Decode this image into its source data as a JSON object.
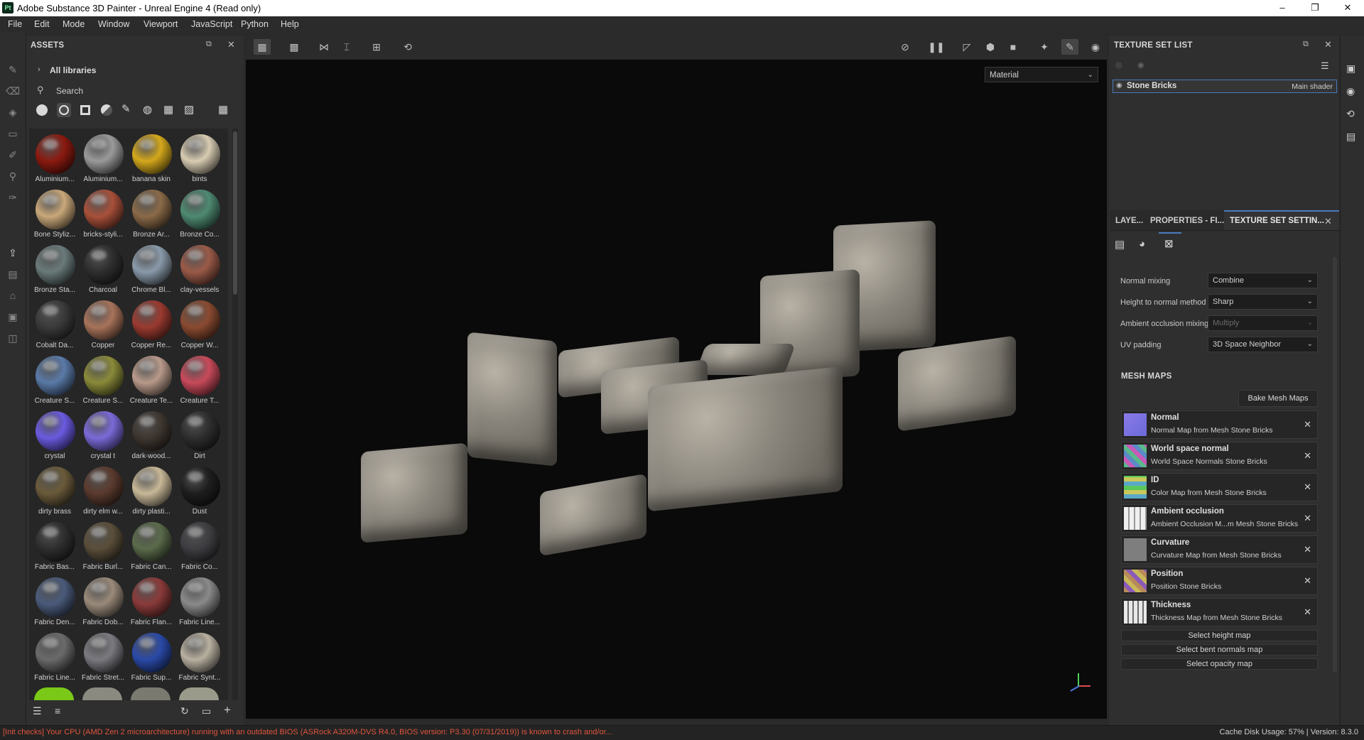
{
  "window": {
    "title": "Adobe Substance 3D Painter - Unreal Engine 4 (Read only)",
    "logo": "Pt",
    "controls": [
      "–",
      "❐",
      "✕"
    ]
  },
  "menu": [
    "File",
    "Edit",
    "Mode",
    "Window",
    "Viewport",
    "JavaScript",
    "Python",
    "Help"
  ],
  "assets": {
    "title": "ASSETS",
    "library": "All libraries",
    "search_placeholder": "Search",
    "items": [
      {
        "label": "Aluminium...",
        "color": "#8a1a10"
      },
      {
        "label": "Aluminium...",
        "color": "#9a9a9a"
      },
      {
        "label": "banana skin",
        "color": "#d4a81c"
      },
      {
        "label": "bints",
        "color": "#d8ccb2"
      },
      {
        "label": "Bone Styliz...",
        "color": "#c9a87a"
      },
      {
        "label": "bricks-styli...",
        "color": "#a8503a"
      },
      {
        "label": "Bronze Ar...",
        "color": "#8a6a48"
      },
      {
        "label": "Bronze Co...",
        "color": "#4e8a72"
      },
      {
        "label": "Bronze Sta...",
        "color": "#6a7a7a"
      },
      {
        "label": "Charcoal",
        "color": "#2e2e2e"
      },
      {
        "label": "Chrome Bl...",
        "color": "#8a9aaa"
      },
      {
        "label": "clay-vessels",
        "color": "#9a5a48"
      },
      {
        "label": "Cobalt Da...",
        "color": "#3a3a3a"
      },
      {
        "label": "Copper",
        "color": "#a8735a"
      },
      {
        "label": "Copper Re...",
        "color": "#9a3a30"
      },
      {
        "label": "Copper W...",
        "color": "#8a4a30"
      },
      {
        "label": "Creature S...",
        "color": "#5a7aa8"
      },
      {
        "label": "Creature S...",
        "color": "#8a8a3a"
      },
      {
        "label": "Creature Te...",
        "color": "#b89a8a"
      },
      {
        "label": "Creature T...",
        "color": "#c84a5a"
      },
      {
        "label": "crystal",
        "color": "#6a5ae0"
      },
      {
        "label": "crystal t",
        "color": "#7a6ad8"
      },
      {
        "label": "dark-wood...",
        "color": "#3e3630"
      },
      {
        "label": "Dirt",
        "color": "#2e2e2e"
      },
      {
        "label": "dirty brass",
        "color": "#6a5a3a"
      },
      {
        "label": "dirty elm w...",
        "color": "#5a3a2e"
      },
      {
        "label": "dirty plasti...",
        "color": "#c8b898"
      },
      {
        "label": "Dust",
        "color": "#1e1e1e"
      },
      {
        "label": "Fabric Bas...",
        "color": "#2e2e2e"
      },
      {
        "label": "Fabric Burl...",
        "color": "#5a4e3a"
      },
      {
        "label": "Fabric Can...",
        "color": "#5a6a4a"
      },
      {
        "label": "Fabric Co...",
        "color": "#3e3e42"
      },
      {
        "label": "Fabric Den...",
        "color": "#4a5a7a"
      },
      {
        "label": "Fabric Dob...",
        "color": "#9a8a7a"
      },
      {
        "label": "Fabric Flan...",
        "color": "#8a3a3a"
      },
      {
        "label": "Fabric Line...",
        "color": "#8a8a8a"
      },
      {
        "label": "Fabric Line...",
        "color": "#6a6a6a"
      },
      {
        "label": "Fabric Stret...",
        "color": "#7a7a80"
      },
      {
        "label": "Fabric Sup...",
        "color": "#2a4aa8"
      },
      {
        "label": "Fabric Synt...",
        "color": "#b8b0a0"
      }
    ]
  },
  "viewport": {
    "material_mode": "Material"
  },
  "texture_set_list": {
    "title": "TEXTURE SET LIST",
    "set_name": "Stone Bricks",
    "shader": "Main shader"
  },
  "tabs": [
    "LAYE...",
    "PROPERTIES - FI...",
    "TEXTURE SET SETTIN..."
  ],
  "settings": {
    "rows": [
      {
        "label": "Normal mixing",
        "value": "Combine",
        "disabled": false
      },
      {
        "label": "Height to normal method",
        "value": "Sharp",
        "disabled": false
      },
      {
        "label": "Ambient occlusion mixing",
        "value": "Multiply",
        "disabled": true
      },
      {
        "label": "UV padding",
        "value": "3D Space Neighbor",
        "disabled": false
      }
    ],
    "mesh_maps_title": "MESH MAPS",
    "bake_label": "Bake Mesh Maps",
    "mesh_maps": [
      {
        "title": "Normal",
        "sub": "Normal Map from Mesh Stone Bricks",
        "color": "#7a7ae8"
      },
      {
        "title": "World space normal",
        "sub": "World Space Normals Stone Bricks",
        "color": "#5ab88a"
      },
      {
        "title": "ID",
        "sub": "Color Map from Mesh Stone Bricks",
        "color": "#5aa8c8"
      },
      {
        "title": "Ambient occlusion",
        "sub": "Ambient Occlusion M...m Mesh Stone Bricks",
        "color": "#e0e0e0"
      },
      {
        "title": "Curvature",
        "sub": "Curvature Map from Mesh Stone Bricks",
        "color": "#8a8a8a"
      },
      {
        "title": "Position",
        "sub": "Position Stone Bricks",
        "color": "#b88a5a"
      },
      {
        "title": "Thickness",
        "sub": "Thickness Map from Mesh Stone Bricks",
        "color": "#cfcfcf"
      }
    ],
    "select_buttons": [
      "Select height map",
      "Select bent normals map",
      "Select opacity map"
    ]
  },
  "status": {
    "warning": "[Init checks] Your CPU (AMD Zen 2 microarchitecture) running with an outdated BIOS (ASRock A320M-DVS R4.0, BIOS version: P3.30 (07/31/2019)) is known to crash and/or...",
    "cache": "Cache Disk Usage:   57% | Version: 8.3.0"
  }
}
